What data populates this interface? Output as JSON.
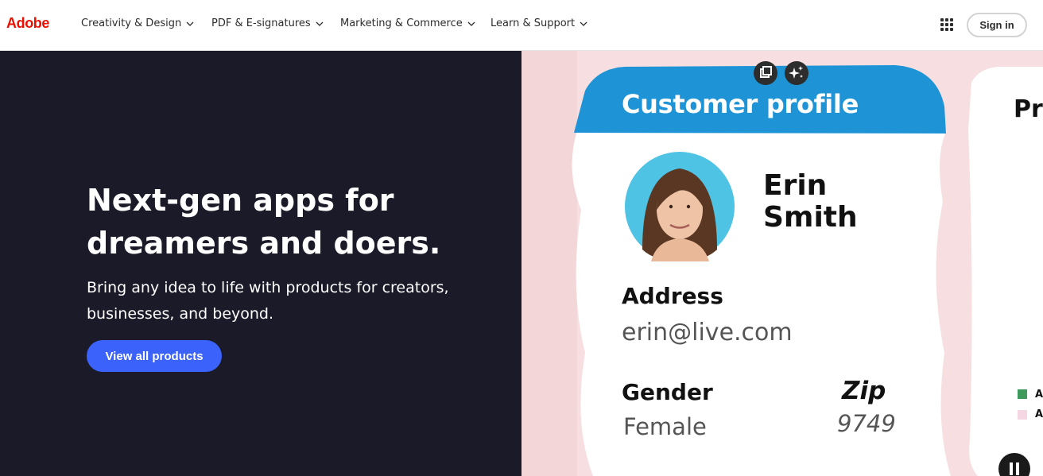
{
  "brand": {
    "logo": "Adobe",
    "accent": "#eb1000"
  },
  "nav": {
    "items": [
      {
        "label": "Creativity & Design"
      },
      {
        "label": "PDF & E-signatures"
      },
      {
        "label": "Marketing & Commerce"
      },
      {
        "label": "Learn & Support"
      }
    ],
    "apps_icon": "app-grid-icon",
    "sign_in": "Sign in"
  },
  "hero": {
    "headline": "Next-gen apps for dreamers and doers.",
    "subhead": "Bring any idea to life with products for creators, businesses, and beyond.",
    "cta": "View all products",
    "cta_color": "#3b63fb",
    "background": "#1b1a28"
  },
  "illustration": {
    "card_title": "Customer profile",
    "first_name": "Erin",
    "last_name": "Smith",
    "address_label": "Address",
    "address_value": "erin@live.com",
    "gender_label": "Gender",
    "gender_value": "Female",
    "zip_label": "Zip",
    "zip_value": "9749",
    "second_card_title_partial": "Pr",
    "legend_a1": "A",
    "legend_a2": "A",
    "card_header_color": "#1e94d6",
    "controls": [
      "copy-icon",
      "sparkle-icon"
    ],
    "pause_icon": "pause-icon"
  }
}
